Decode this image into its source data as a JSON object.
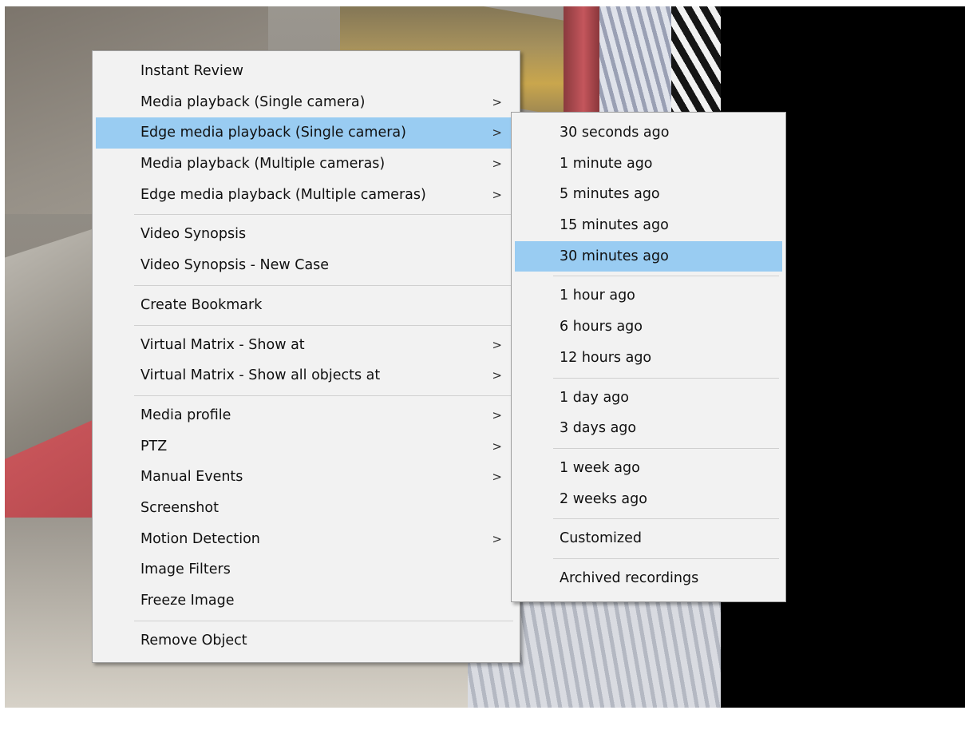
{
  "colors": {
    "menu_bg": "#f2f2f2",
    "highlight": "#99ccf2",
    "border": "#a0a0a0"
  },
  "main_menu": {
    "groups": [
      [
        {
          "label": "Instant Review",
          "submenu": false
        },
        {
          "label": "Media playback (Single camera)",
          "submenu": true
        },
        {
          "label": "Edge media playback (Single camera)",
          "submenu": true,
          "highlighted": true
        },
        {
          "label": "Media playback (Multiple cameras)",
          "submenu": true
        },
        {
          "label": "Edge media playback (Multiple cameras)",
          "submenu": true
        }
      ],
      [
        {
          "label": "Video Synopsis",
          "submenu": false
        },
        {
          "label": "Video Synopsis - New Case",
          "submenu": false
        }
      ],
      [
        {
          "label": "Create Bookmark",
          "submenu": false
        }
      ],
      [
        {
          "label": "Virtual Matrix - Show at",
          "submenu": true
        },
        {
          "label": "Virtual Matrix - Show all objects at",
          "submenu": true
        }
      ],
      [
        {
          "label": "Media profile",
          "submenu": true
        },
        {
          "label": "PTZ",
          "submenu": true
        },
        {
          "label": "Manual Events",
          "submenu": true
        },
        {
          "label": "Screenshot",
          "submenu": false
        },
        {
          "label": "Motion Detection",
          "submenu": true
        },
        {
          "label": "Image Filters",
          "submenu": false
        },
        {
          "label": "Freeze Image",
          "submenu": false
        }
      ],
      [
        {
          "label": "Remove Object",
          "submenu": false
        }
      ]
    ]
  },
  "sub_menu": {
    "groups": [
      [
        {
          "label": "30 seconds ago"
        },
        {
          "label": "1 minute ago"
        },
        {
          "label": "5 minutes ago"
        },
        {
          "label": "15 minutes ago"
        },
        {
          "label": "30 minutes ago",
          "highlighted": true
        }
      ],
      [
        {
          "label": "1 hour ago"
        },
        {
          "label": "6 hours ago"
        },
        {
          "label": "12 hours ago"
        }
      ],
      [
        {
          "label": "1 day ago"
        },
        {
          "label": "3 days ago"
        }
      ],
      [
        {
          "label": "1 week ago"
        },
        {
          "label": "2 weeks ago"
        }
      ],
      [
        {
          "label": "Customized"
        }
      ],
      [
        {
          "label": "Archived recordings"
        }
      ]
    ]
  },
  "icons": {
    "submenu_arrow": "chevron-right-icon",
    "arrow_glyph": ">"
  }
}
